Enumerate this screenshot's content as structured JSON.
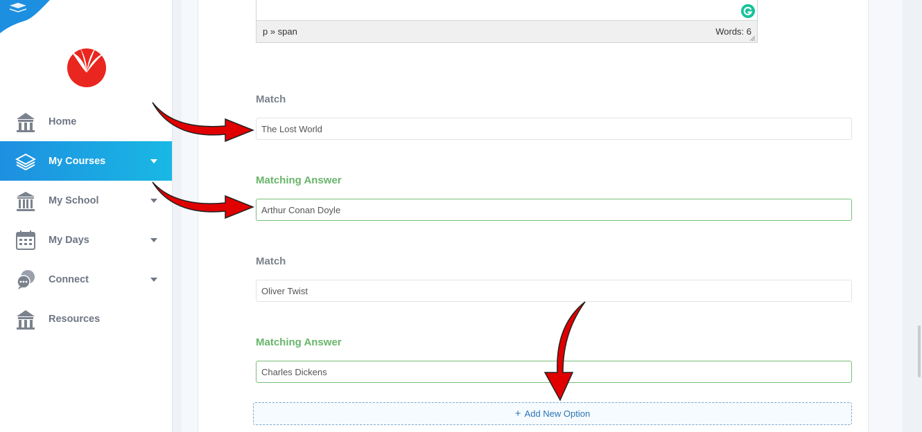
{
  "sidebar": {
    "items": [
      {
        "label": "Home",
        "icon": "home-icon",
        "has_caret": false,
        "active": false
      },
      {
        "label": "My Courses",
        "icon": "courses-stack-icon",
        "has_caret": true,
        "active": true
      },
      {
        "label": "My School",
        "icon": "school-building-icon",
        "has_caret": true,
        "active": false
      },
      {
        "label": "My Days",
        "icon": "calendar-icon",
        "has_caret": true,
        "active": false
      },
      {
        "label": "Connect",
        "icon": "chat-bubbles-icon",
        "has_caret": true,
        "active": false
      },
      {
        "label": "Resources",
        "icon": "resources-building-icon",
        "has_caret": false,
        "active": false
      }
    ]
  },
  "editor": {
    "path": "p » span",
    "word_count": "Words: 6"
  },
  "fields": [
    {
      "label": "Match",
      "value": "The Lost World",
      "variant": "match"
    },
    {
      "label": "Matching Answer",
      "value": "Arthur Conan Doyle",
      "variant": "answer"
    },
    {
      "label": "Match",
      "value": "Oliver Twist",
      "variant": "match"
    },
    {
      "label": "Matching Answer",
      "value": "Charles Dickens",
      "variant": "answer"
    }
  ],
  "add_option": {
    "plus": "+",
    "label": "Add New Option"
  },
  "colors": {
    "active_nav": "#1e8fe0",
    "answer_green": "#69b56b",
    "link_blue": "#2a74b6",
    "annotation_arrow": "#e00000",
    "logo_red": "#e9261f"
  }
}
